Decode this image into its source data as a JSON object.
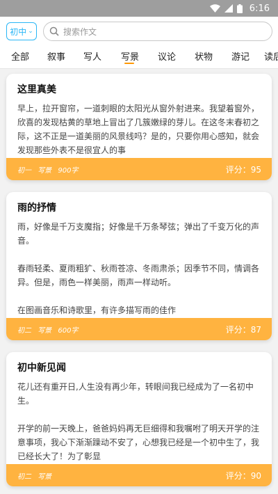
{
  "status": {
    "time": "6:16"
  },
  "search": {
    "grade_label": "初中",
    "placeholder": "搜索作文"
  },
  "tabs": [
    "全部",
    "叙事",
    "写人",
    "写景",
    "议论",
    "状物",
    "游记",
    "读后"
  ],
  "active_tab": "写景",
  "cards": [
    {
      "title": "这里真美",
      "paragraphs": [
        "早上，拉开窗帘，一道刺眼的太阳光从窗外射进来。我望着窗外，欣喜的发现枯黄的草地上冒出了几簇嫩绿的芽儿。在这冬末春初之际，这不正是一道美丽的风景线吗？是的，只要你用心感知，就会发现那些外表不是很宜人的事"
      ],
      "grade": "初一",
      "genre": "写景",
      "words": "900字",
      "score": "评分：95"
    },
    {
      "title": "雨的抒情",
      "paragraphs": [
        "雨，好像是千万支魔指；好像是千万条琴弦；弹出了千变万化的声音。",
        "春雨轻柔、夏雨粗犷、秋雨苍凉、冬雨肃杀；因季节不同，情调各异。但是，雨色一样美丽，雨声一样动听。",
        "在图画音乐和诗歌里，有许多描写雨的佳作"
      ],
      "grade": "初二",
      "genre": "写景",
      "words": "600字",
      "score": "评分：87"
    },
    {
      "title": "初中新见闻",
      "paragraphs": [
        "花儿还有重开日,人生没有再少年，转眼间我已经成为了一名初中生。",
        "开学的前一天晚上，爸爸妈妈再无巨细得和我嘱咐了明天开学的注意事项，我心下渐渐躁动不安了，心想我已经是一个初中生了，我已经长大了！为了彰显"
      ],
      "grade": "初二",
      "genre": "写景",
      "words": "",
      "score": "评分：90"
    }
  ]
}
